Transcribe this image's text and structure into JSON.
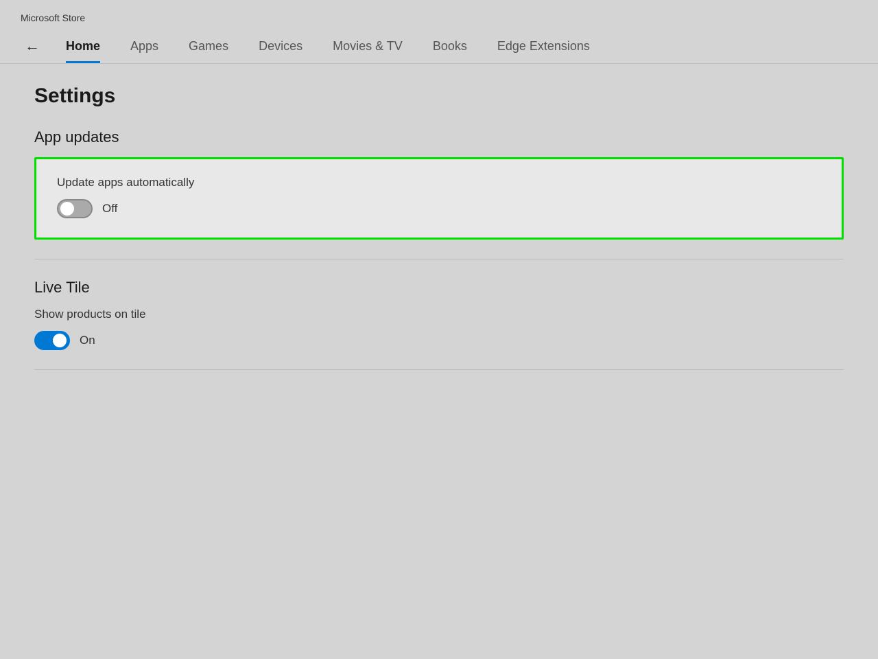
{
  "app": {
    "title": "Microsoft Store"
  },
  "nav": {
    "back_icon": "←",
    "items": [
      {
        "label": "Home",
        "active": true
      },
      {
        "label": "Apps",
        "active": false
      },
      {
        "label": "Games",
        "active": false
      },
      {
        "label": "Devices",
        "active": false
      },
      {
        "label": "Movies & TV",
        "active": false
      },
      {
        "label": "Books",
        "active": false
      },
      {
        "label": "Edge Extensions",
        "active": false
      }
    ]
  },
  "page": {
    "title": "Settings"
  },
  "sections": {
    "app_updates": {
      "title": "App updates",
      "setting": {
        "label": "Update apps automatically",
        "toggle_state": "off",
        "toggle_label": "Off"
      }
    },
    "live_tile": {
      "title": "Live Tile",
      "setting": {
        "label": "Show products on tile",
        "toggle_state": "on",
        "toggle_label": "On"
      }
    }
  },
  "colors": {
    "highlight_border": "#00e000",
    "toggle_on": "#0078d4",
    "toggle_off": "#aaaaaa",
    "nav_active_underline": "#0078d4"
  }
}
